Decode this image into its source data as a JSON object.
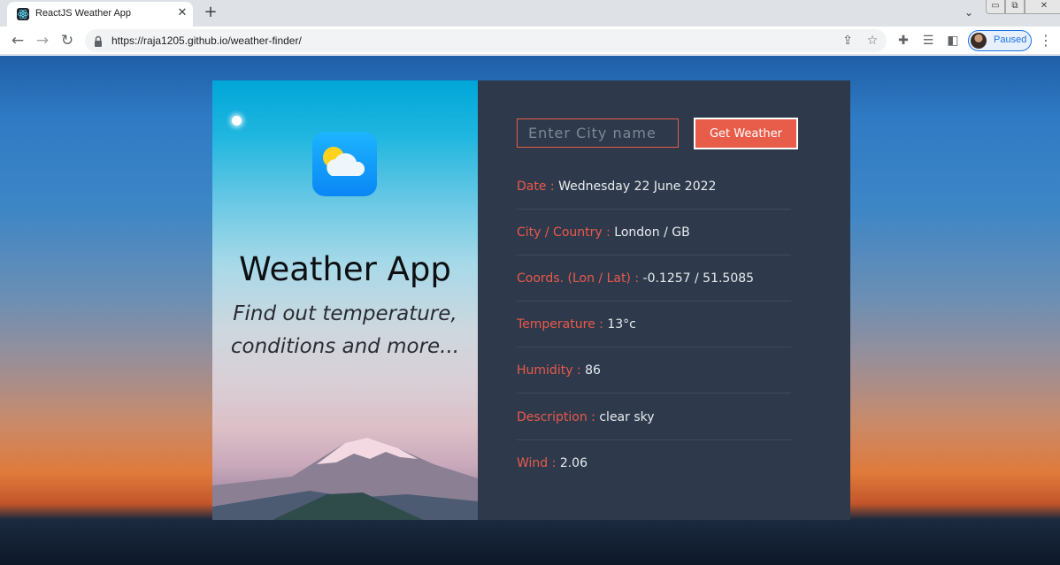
{
  "browser": {
    "tab_title": "ReactJS Weather App",
    "tab_close": "✕",
    "new_tab": "+",
    "url": "https://raja1205.github.io/weather-finder/",
    "profile_label": "Paused"
  },
  "app": {
    "title": "Weather App",
    "subtitle_line1": "Find out temperature,",
    "subtitle_line2": "conditions and more..."
  },
  "form": {
    "city_placeholder": "Enter City name",
    "submit_label": "Get Weather"
  },
  "weather": {
    "rows": [
      {
        "label": "Date : ",
        "value": "Wednesday 22 June 2022"
      },
      {
        "label": "City / Country : ",
        "value": "London / GB"
      },
      {
        "label": "Coords. (Lon / Lat) : ",
        "value": "-0.1257 / 51.5085"
      },
      {
        "label": "Temperature : ",
        "value": "13°c"
      },
      {
        "label": "Humidity : ",
        "value": "86"
      },
      {
        "label": "Description : ",
        "value": "clear sky"
      },
      {
        "label": "Wind : ",
        "value": "2.06"
      }
    ]
  },
  "colors": {
    "accent": "#e9594a",
    "panel_bg": "#2e3a4b",
    "value_text": "#e9ecef"
  },
  "icons": [
    "react-favicon",
    "close-icon",
    "plus-icon",
    "chevron-down-icon",
    "minimize-icon",
    "restore-icon",
    "close-window-icon",
    "back-arrow-icon",
    "forward-arrow-icon",
    "reload-icon",
    "lock-icon",
    "share-icon",
    "star-icon",
    "extensions-icon",
    "reading-list-icon",
    "side-panel-icon",
    "avatar",
    "more-vert-icon",
    "weather-sun-cloud-icon"
  ]
}
